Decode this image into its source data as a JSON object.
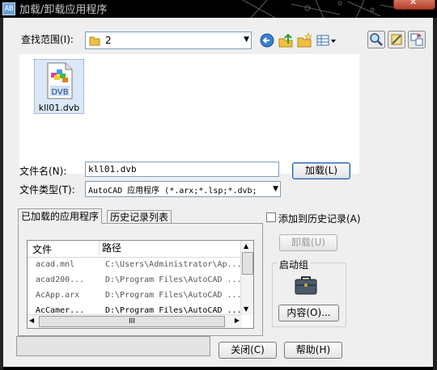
{
  "window": {
    "title": "加载/卸载应用程序",
    "title_icon_text": "AB"
  },
  "lookin": {
    "label": "查找范围(I):",
    "value": "2",
    "tools": [
      "back-icon",
      "up-folder-icon",
      "new-folder-icon",
      "views-menu-icon"
    ],
    "right_tools": [
      "find-icon",
      "tools-icon",
      "favorites-icon"
    ]
  },
  "files": [
    {
      "name": "kll01.dvb",
      "icon_label": "DVB"
    }
  ],
  "filename": {
    "label": "文件名(N):",
    "value": "kll01.dvb"
  },
  "filetype": {
    "label": "文件类型(T):",
    "value": "AutoCAD 应用程序 (*.arx;*.lsp;*.dvb;"
  },
  "load_button": "加载(L)",
  "tabs": [
    {
      "label": "已加载的应用程序",
      "active": true
    },
    {
      "label": "历史记录列表",
      "active": false
    }
  ],
  "loaded_list": {
    "headers": [
      "文件",
      "路径"
    ],
    "rows": [
      [
        "acad.mnl",
        "C:\\Users\\Administrator\\Ap..."
      ],
      [
        "acad200...",
        "D:\\Program Files\\AutoCAD ..."
      ],
      [
        "AcApp.arx",
        "D:\\Program Files\\AutoCAD ..."
      ],
      [
        "AcCamer...",
        "D:\\Program Files\\AutoCAD ..."
      ]
    ],
    "hscroll_thumb": "III"
  },
  "add_history": {
    "label": "添加到历史记录(A)",
    "checked": false
  },
  "unload_button": "卸载(U)",
  "startup": {
    "title": "启动组",
    "contents_button": "内容(O)..."
  },
  "close_button": "关闭(C)",
  "help_button": "帮助(H)",
  "colors": {
    "dialog_bg": "#efefef",
    "title_bg": "#000000",
    "selection": "#dbe8f7",
    "accent": "#2a5faa"
  }
}
